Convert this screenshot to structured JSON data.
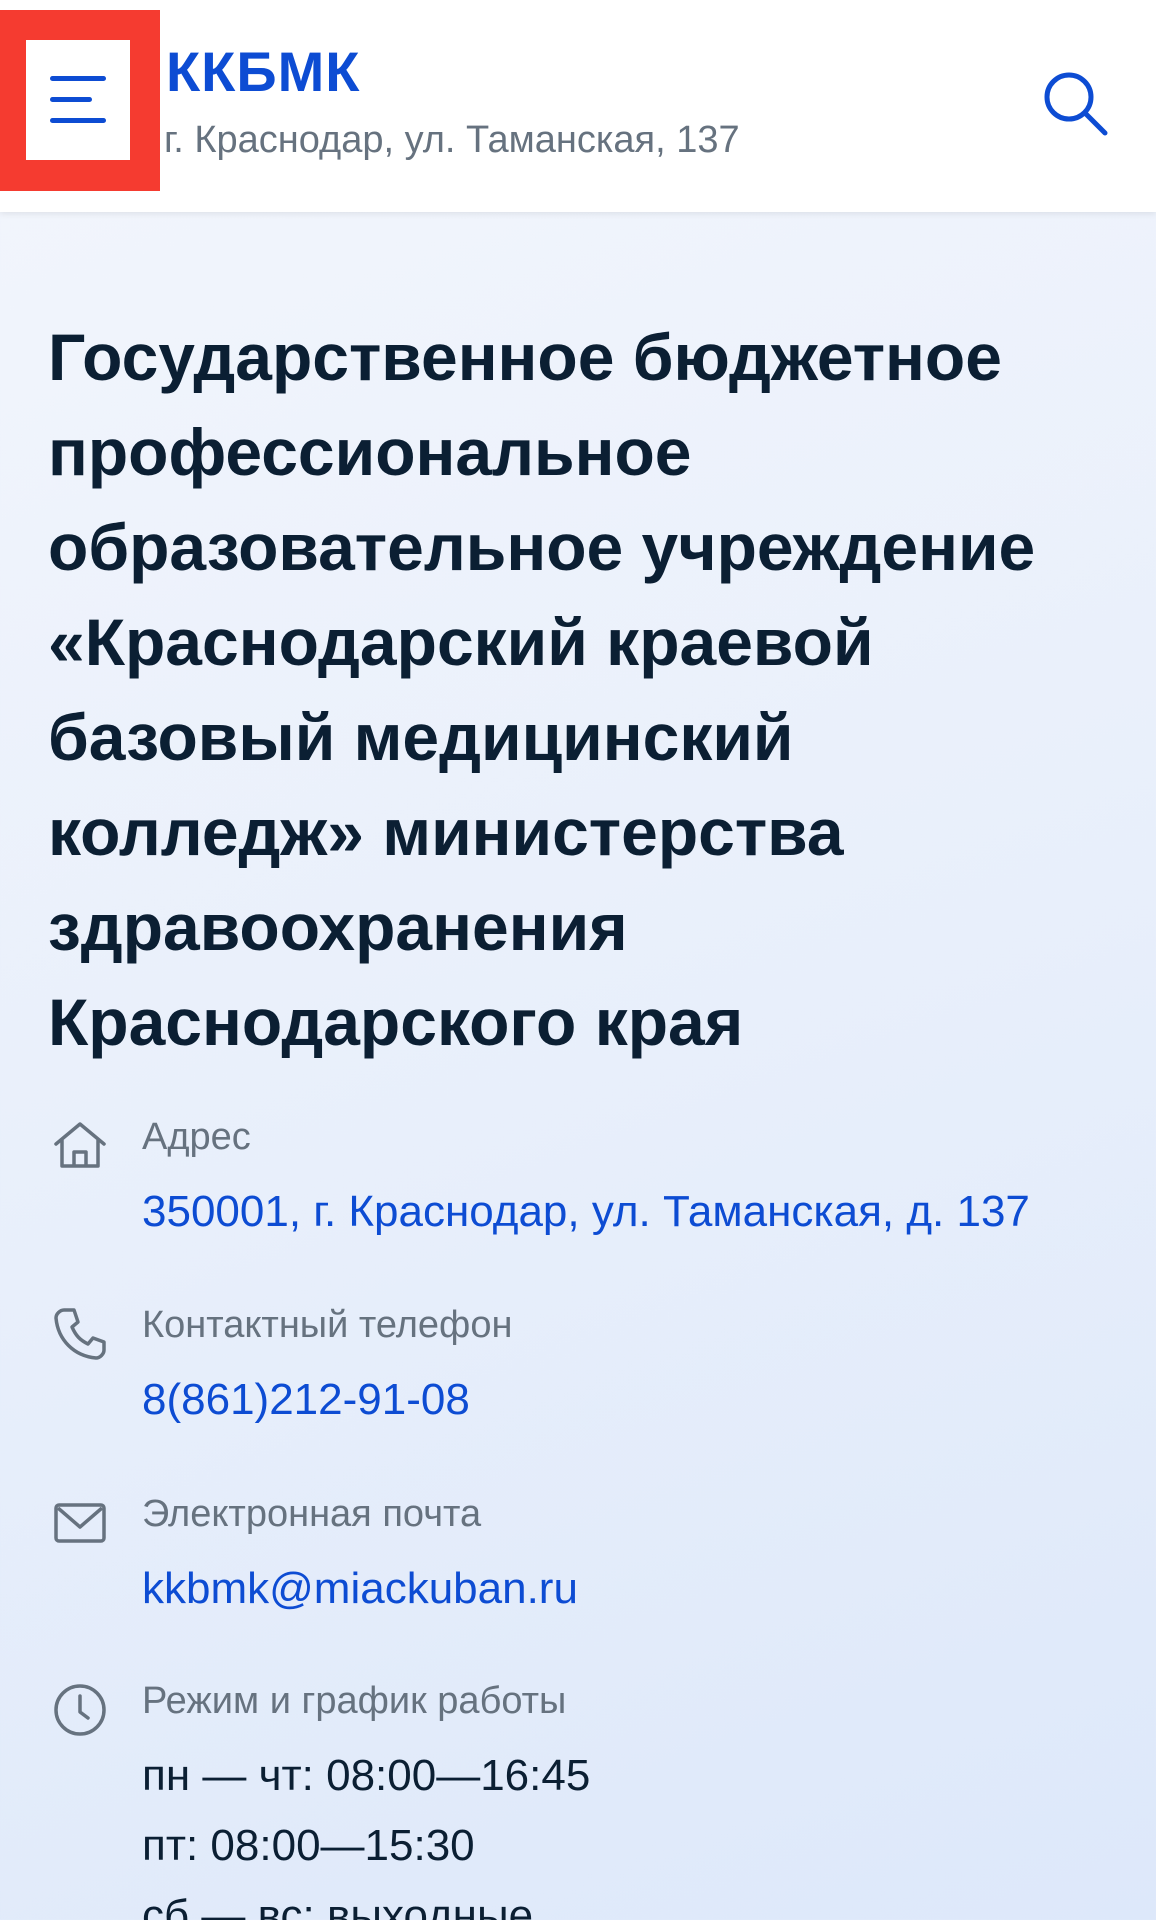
{
  "header": {
    "title": "ККБМК",
    "subtitle": "г. Краснодар, ул. Таманская, 137",
    "menu_icon": "hamburger-menu-icon",
    "search_icon": "search-icon",
    "accent_color": "#0d4cd3",
    "highlight_color": "#f53b30"
  },
  "organization": {
    "full_name": "Государственное бюджетное профессиональное образовательное учреждение «Краснодарский краевой базовый медицинский колледж» министерства здравоохранения Краснодарского края"
  },
  "contacts": {
    "address": {
      "icon": "home-icon",
      "label": "Адрес",
      "value": "350001, г. Краснодар, ул. Таманская, д. 137"
    },
    "phone": {
      "icon": "phone-icon",
      "label": "Контактный телефон",
      "value": "8(861)212-91-08"
    },
    "email": {
      "icon": "mail-icon",
      "label": "Электронная почта",
      "value": "kkbmk@miackuban.ru"
    },
    "schedule": {
      "icon": "clock-icon",
      "label": "Режим и график работы",
      "lines": [
        "пн — чт: 08:00—16:45",
        "пт: 08:00—15:30",
        "сб — вс: выходные"
      ]
    }
  }
}
